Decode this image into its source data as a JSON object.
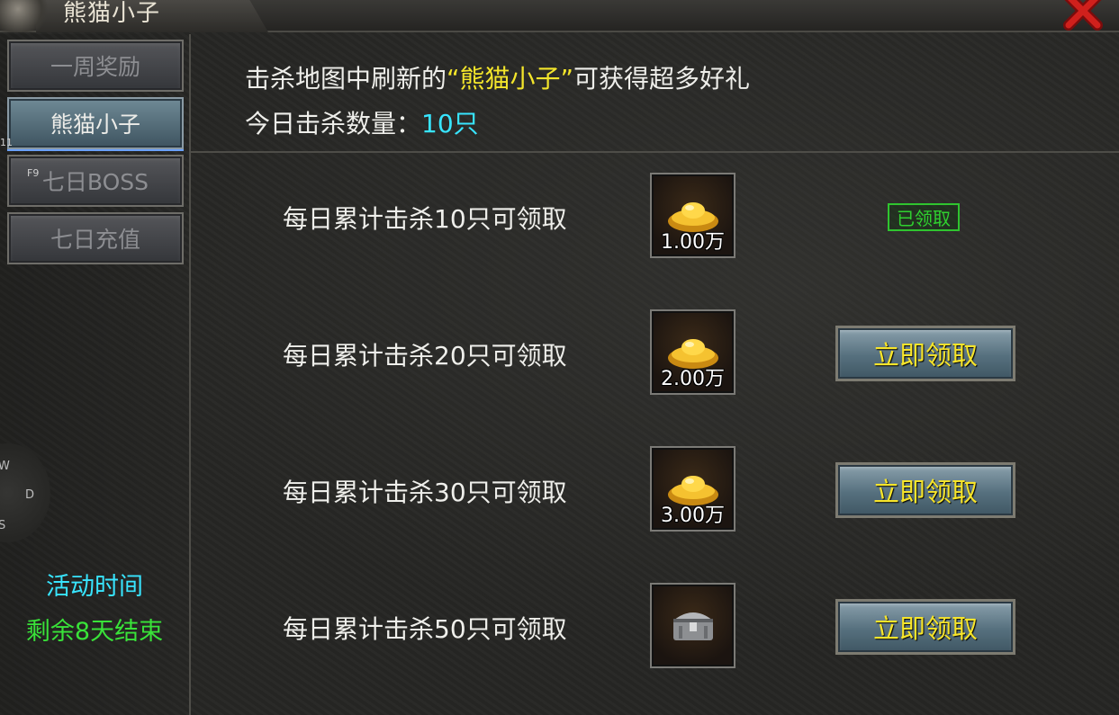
{
  "window": {
    "title": "熊猫小子",
    "close_icon": "close-x-icon"
  },
  "sidebar": {
    "tabs": [
      {
        "label": "一周奖励",
        "active": false
      },
      {
        "label": "熊猫小子",
        "active": true
      },
      {
        "label": "七日BOSS",
        "active": false
      },
      {
        "label": "七日充值",
        "active": false
      }
    ],
    "hotkeys": {
      "h1": "11",
      "h2": "F9"
    },
    "compass": {
      "w": "W",
      "d": "D",
      "s": "S"
    },
    "event_time_label": "活动时间",
    "event_time_remaining": "剩余8天结束",
    "colors": {
      "event_label": "#38e5ff",
      "event_remaining": "#39e339"
    }
  },
  "header": {
    "line1_prefix": "击杀地图中刷新的",
    "line1_highlight": "“熊猫小子”",
    "line1_suffix": "可获得超多好礼",
    "line2_label": "今日击杀数量：",
    "line2_count": "10只"
  },
  "rewards": [
    {
      "label": "每日累计击杀10只可领取",
      "item_icon": "gold-ingot-icon",
      "quantity": "1.00万",
      "status": "claimed",
      "status_label": "已领取"
    },
    {
      "label": "每日累计击杀20只可领取",
      "item_icon": "gold-ingot-icon",
      "quantity": "2.00万",
      "status": "claimable",
      "button_label": "立即领取"
    },
    {
      "label": "每日累计击杀30只可领取",
      "item_icon": "gold-ingot-icon",
      "quantity": "3.00万",
      "status": "claimable",
      "button_label": "立即领取"
    },
    {
      "label": "每日累计击杀50只可领取",
      "item_icon": "treasure-chest-icon",
      "quantity": "",
      "status": "claimable",
      "button_label": "立即领取"
    }
  ],
  "colors": {
    "highlight_name": "#f3e52b",
    "kill_count": "#38e5ff",
    "claimed": "#2fd12f",
    "button_text": "#f7e52a"
  }
}
